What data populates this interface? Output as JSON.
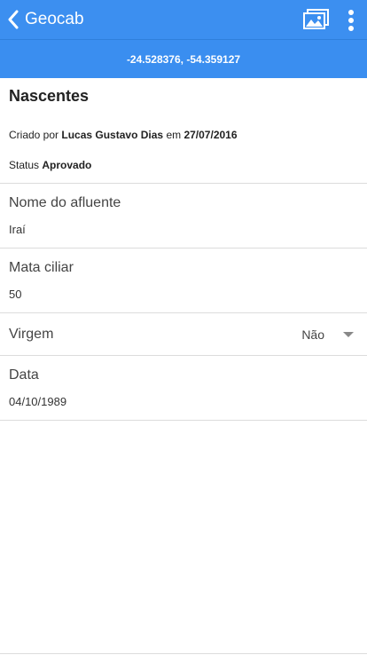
{
  "header": {
    "back_icon": "chevron-left-icon",
    "title": "Geocab",
    "gallery_icon": "images-icon",
    "more_icon": "more-vertical-icon"
  },
  "coordinates": "-24.528376, -54.359127",
  "record": {
    "title": "Nascentes",
    "created_prefix": "Criado por",
    "author": "Lucas Gustavo Dias",
    "created_mid": "em",
    "date": "27/07/2016",
    "status_label": "Status",
    "status_value": "Aprovado"
  },
  "fields": [
    {
      "label": "Nome do afluente",
      "value": "Iraí"
    },
    {
      "label": "Mata ciliar",
      "value": "50"
    },
    {
      "label": "Virgem",
      "value": "Não"
    },
    {
      "label": "Data",
      "value": "04/10/1989"
    }
  ],
  "colors": {
    "appbar": "#3c8ff0",
    "subbar": "#3a8ef0",
    "divider": "#dcdcdc"
  }
}
